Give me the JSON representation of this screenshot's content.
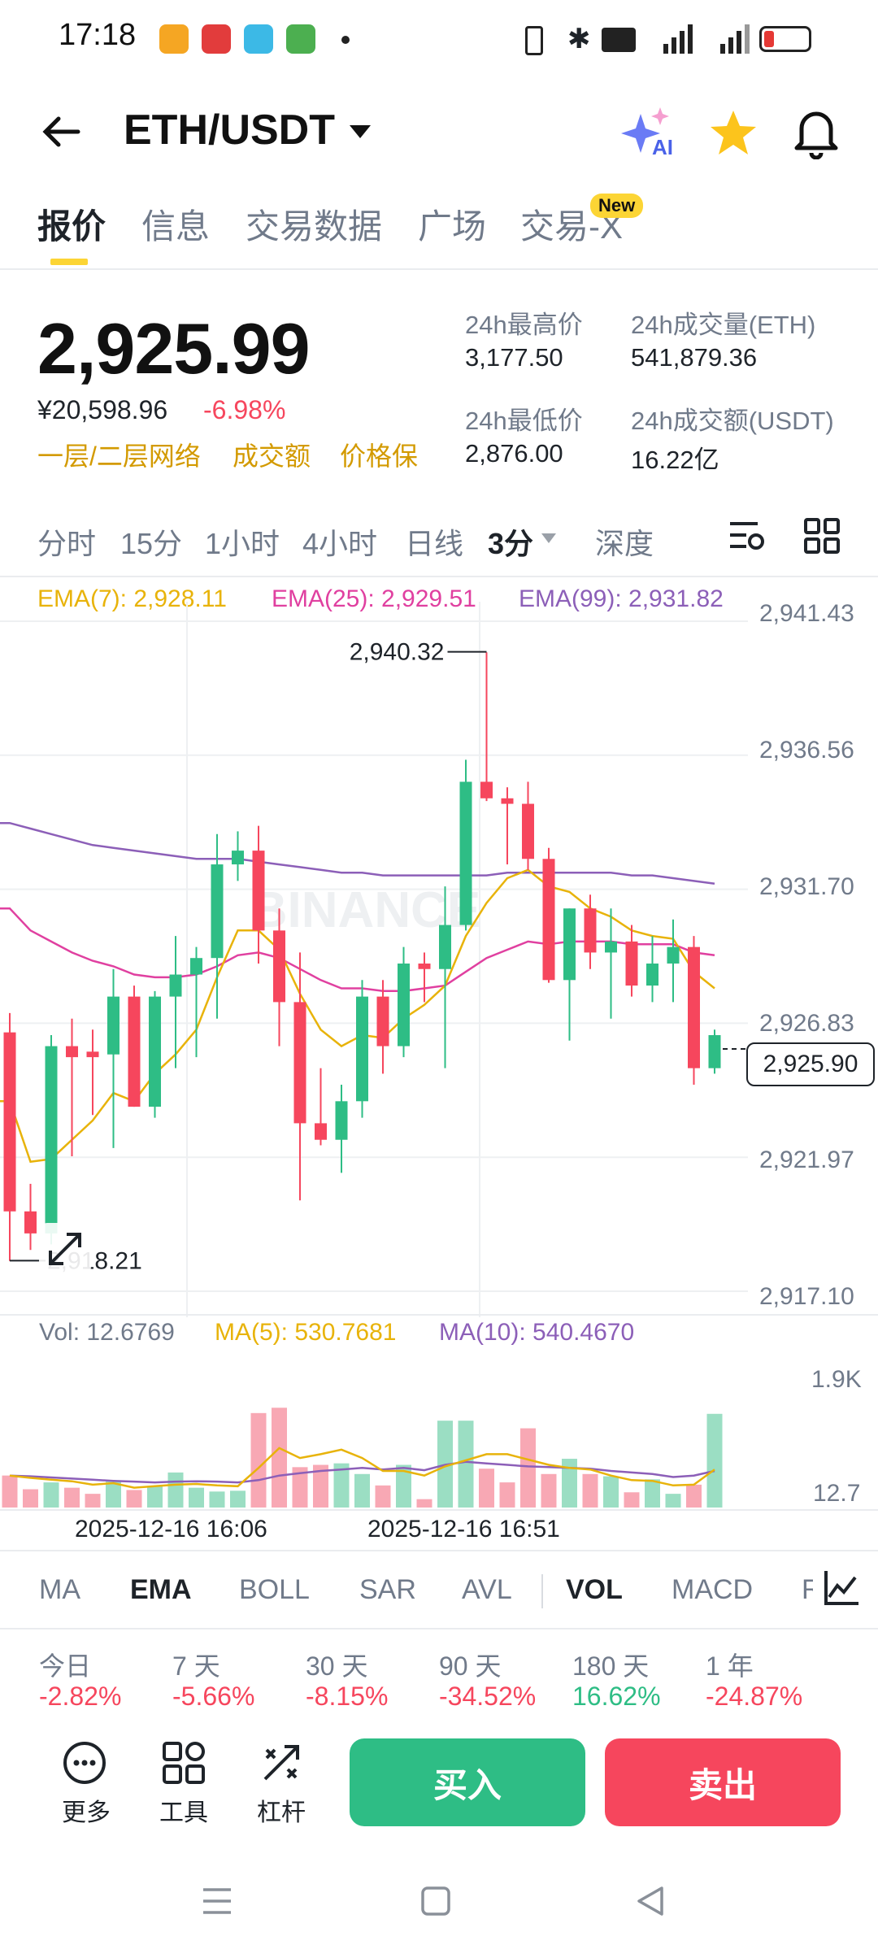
{
  "status_bar": {
    "time": "17:18"
  },
  "header": {
    "pair": "ETH/USDT",
    "ai_label": "AI"
  },
  "tabs": [
    {
      "label": "报价",
      "active": true
    },
    {
      "label": "信息"
    },
    {
      "label": "交易数据"
    },
    {
      "label": "广场"
    },
    {
      "label": "交易-X",
      "badge": "New"
    }
  ],
  "price": {
    "last": "2,925.99",
    "cny": "¥20,598.96",
    "change": "-6.98%",
    "tags": [
      "一层/二层网络",
      "成交额",
      "价格保"
    ]
  },
  "stats": {
    "high_label": "24h最高价",
    "high": "3,177.50",
    "low_label": "24h最低价",
    "low": "2,876.00",
    "vol_eth_label": "24h成交量(ETH)",
    "vol_eth": "541,879.36",
    "vol_usdt_label": "24h成交额(USDT)",
    "vol_usdt": "16.22亿"
  },
  "intervals": [
    "分时",
    "15分",
    "1小时",
    "4小时",
    "日线",
    "3分",
    "深度"
  ],
  "ema": {
    "ema7": "EMA(7): 2,928.11",
    "ema25": "EMA(25): 2,929.51",
    "ema99": "EMA(99): 2,931.82"
  },
  "colors": {
    "up": "#2ebd85",
    "down": "#f6465d",
    "ema7": "#e8b30a",
    "ema25": "#e040a0",
    "ema99": "#8c5fb8",
    "accent": "#fcd535"
  },
  "chart_data": {
    "type": "candlestick",
    "price_axis": [
      "2,941.43",
      "2,936.56",
      "2,931.70",
      "2,926.83",
      "2,921.97",
      "2,917.10"
    ],
    "ylim": [
      2917.1,
      2941.43
    ],
    "high_annot": "2,940.32",
    "low_annot": "2,918.21",
    "current_price": "2,925.90",
    "time_labels": [
      "2025-12-16 16:06",
      "2025-12-16 16:51"
    ],
    "candles": [
      [
        2926.5,
        2927.2,
        2918.2,
        2920.0
      ],
      [
        2920.0,
        2921.0,
        2918.6,
        2919.2
      ],
      [
        2919.2,
        2926.4,
        2918.8,
        2926.0
      ],
      [
        2926.0,
        2927.0,
        2922.0,
        2925.6
      ],
      [
        2925.8,
        2926.6,
        2923.5,
        2925.6
      ],
      [
        2925.7,
        2928.8,
        2922.3,
        2927.8
      ],
      [
        2927.8,
        2928.2,
        2923.8,
        2923.8
      ],
      [
        2923.8,
        2928.0,
        2923.4,
        2927.8
      ],
      [
        2927.8,
        2930.0,
        2925.2,
        2928.6
      ],
      [
        2928.6,
        2929.6,
        2925.6,
        2929.2
      ],
      [
        2929.2,
        2933.7,
        2927.0,
        2932.6
      ],
      [
        2932.6,
        2933.8,
        2932.0,
        2933.1
      ],
      [
        2933.1,
        2934.0,
        2929.0,
        2930.2
      ],
      [
        2930.2,
        2931.0,
        2926.0,
        2927.6
      ],
      [
        2927.6,
        2929.4,
        2920.4,
        2923.2
      ],
      [
        2923.2,
        2925.2,
        2922.4,
        2922.6
      ],
      [
        2922.6,
        2924.6,
        2921.4,
        2924.0
      ],
      [
        2924.0,
        2928.4,
        2923.4,
        2927.8
      ],
      [
        2927.8,
        2928.4,
        2925.0,
        2926.0
      ],
      [
        2926.0,
        2929.6,
        2925.6,
        2929.0
      ],
      [
        2929.0,
        2929.4,
        2927.6,
        2928.8
      ],
      [
        2928.8,
        2931.8,
        2925.2,
        2930.4
      ],
      [
        2930.4,
        2936.4,
        2930.2,
        2935.6
      ],
      [
        2935.6,
        2940.3,
        2934.9,
        2935.0
      ],
      [
        2935.0,
        2935.4,
        2932.6,
        2934.8
      ],
      [
        2934.8,
        2935.6,
        2932.4,
        2932.8
      ],
      [
        2932.8,
        2933.2,
        2928.3,
        2928.4
      ],
      [
        2928.4,
        2931.0,
        2926.2,
        2931.0
      ],
      [
        2931.0,
        2931.5,
        2928.8,
        2929.4
      ],
      [
        2929.4,
        2931.0,
        2927.0,
        2929.8
      ],
      [
        2929.8,
        2930.4,
        2927.8,
        2928.2
      ],
      [
        2928.2,
        2930.0,
        2927.6,
        2929.0
      ],
      [
        2929.0,
        2930.6,
        2927.6,
        2929.6
      ],
      [
        2929.6,
        2930.0,
        2924.6,
        2925.2
      ],
      [
        2925.2,
        2926.6,
        2925.0,
        2926.4
      ]
    ],
    "ema7": [
      2924.0,
      2921.8,
      2921.9,
      2922.6,
      2923.3,
      2924.3,
      2924.0,
      2925.0,
      2925.7,
      2926.6,
      2928.5,
      2930.2,
      2930.2,
      2929.5,
      2927.9,
      2926.6,
      2926.0,
      2926.4,
      2926.3,
      2927.0,
      2927.5,
      2928.2,
      2930.0,
      2931.2,
      2932.1,
      2932.4,
      2931.8,
      2931.6,
      2931.0,
      2930.7,
      2930.2,
      2930.0,
      2929.9,
      2928.7,
      2928.1
    ],
    "ema25": [
      2931.0,
      2930.2,
      2929.8,
      2929.4,
      2929.1,
      2928.9,
      2928.6,
      2928.5,
      2928.5,
      2928.6,
      2928.9,
      2929.3,
      2929.4,
      2929.2,
      2928.8,
      2928.4,
      2928.1,
      2928.1,
      2928.0,
      2928.0,
      2928.1,
      2928.2,
      2928.7,
      2929.2,
      2929.5,
      2929.8,
      2929.7,
      2929.8,
      2929.8,
      2929.8,
      2929.7,
      2929.7,
      2929.7,
      2929.4,
      2929.3
    ],
    "ema99": [
      2934.1,
      2933.9,
      2933.7,
      2933.5,
      2933.3,
      2933.2,
      2933.1,
      2933.0,
      2932.9,
      2932.8,
      2932.8,
      2932.8,
      2932.7,
      2932.6,
      2932.5,
      2932.4,
      2932.3,
      2932.3,
      2932.2,
      2932.2,
      2932.2,
      2932.2,
      2932.2,
      2932.2,
      2932.3,
      2932.3,
      2932.3,
      2932.3,
      2932.3,
      2932.3,
      2932.2,
      2932.2,
      2932.1,
      2932.0,
      2931.9
    ]
  },
  "volume": {
    "legend_vol": "Vol: 12.6769",
    "legend_ma5": "MA(5): 530.7681",
    "legend_ma10": "MA(10): 540.4670",
    "axis_top": "1.9K",
    "axis_bottom": "12.7",
    "ymax": 1900,
    "values": [
      420,
      240,
      330,
      260,
      180,
      340,
      230,
      280,
      460,
      260,
      210,
      220,
      1240,
      1310,
      530,
      560,
      580,
      440,
      290,
      560,
      110,
      1140,
      1140,
      510,
      330,
      1040,
      440,
      640,
      440,
      410,
      200,
      370,
      180,
      300,
      1230
    ],
    "ma5": [
      420,
      390,
      365,
      345,
      300,
      320,
      260,
      280,
      300,
      310,
      290,
      280,
      520,
      780,
      650,
      700,
      760,
      650,
      480,
      480,
      420,
      540,
      620,
      700,
      700,
      630,
      560,
      520,
      500,
      420,
      360,
      350,
      290,
      300,
      500
    ],
    "ma10": [
      420,
      410,
      395,
      380,
      365,
      350,
      340,
      330,
      340,
      345,
      340,
      330,
      360,
      420,
      450,
      480,
      500,
      520,
      500,
      520,
      490,
      560,
      600,
      580,
      560,
      540,
      530,
      520,
      510,
      480,
      460,
      440,
      400,
      420,
      480
    ]
  },
  "indicators": [
    "MA",
    "EMA",
    "BOLL",
    "SAR",
    "AVL",
    "VOL",
    "MACD",
    "R"
  ],
  "performance": [
    {
      "label": "今日",
      "value": "-2.82%",
      "dir": "down"
    },
    {
      "label": "7 天",
      "value": "-5.66%",
      "dir": "down"
    },
    {
      "label": "30 天",
      "value": "-8.15%",
      "dir": "down"
    },
    {
      "label": "90 天",
      "value": "-34.52%",
      "dir": "down"
    },
    {
      "label": "180 天",
      "value": "16.62%",
      "dir": "up"
    },
    {
      "label": "1 年",
      "value": "-24.87%",
      "dir": "down"
    }
  ],
  "bottom": {
    "more": "更多",
    "tools": "工具",
    "leverage": "杠杆",
    "buy": "买入",
    "sell": "卖出"
  },
  "watermark": "BINANCE"
}
